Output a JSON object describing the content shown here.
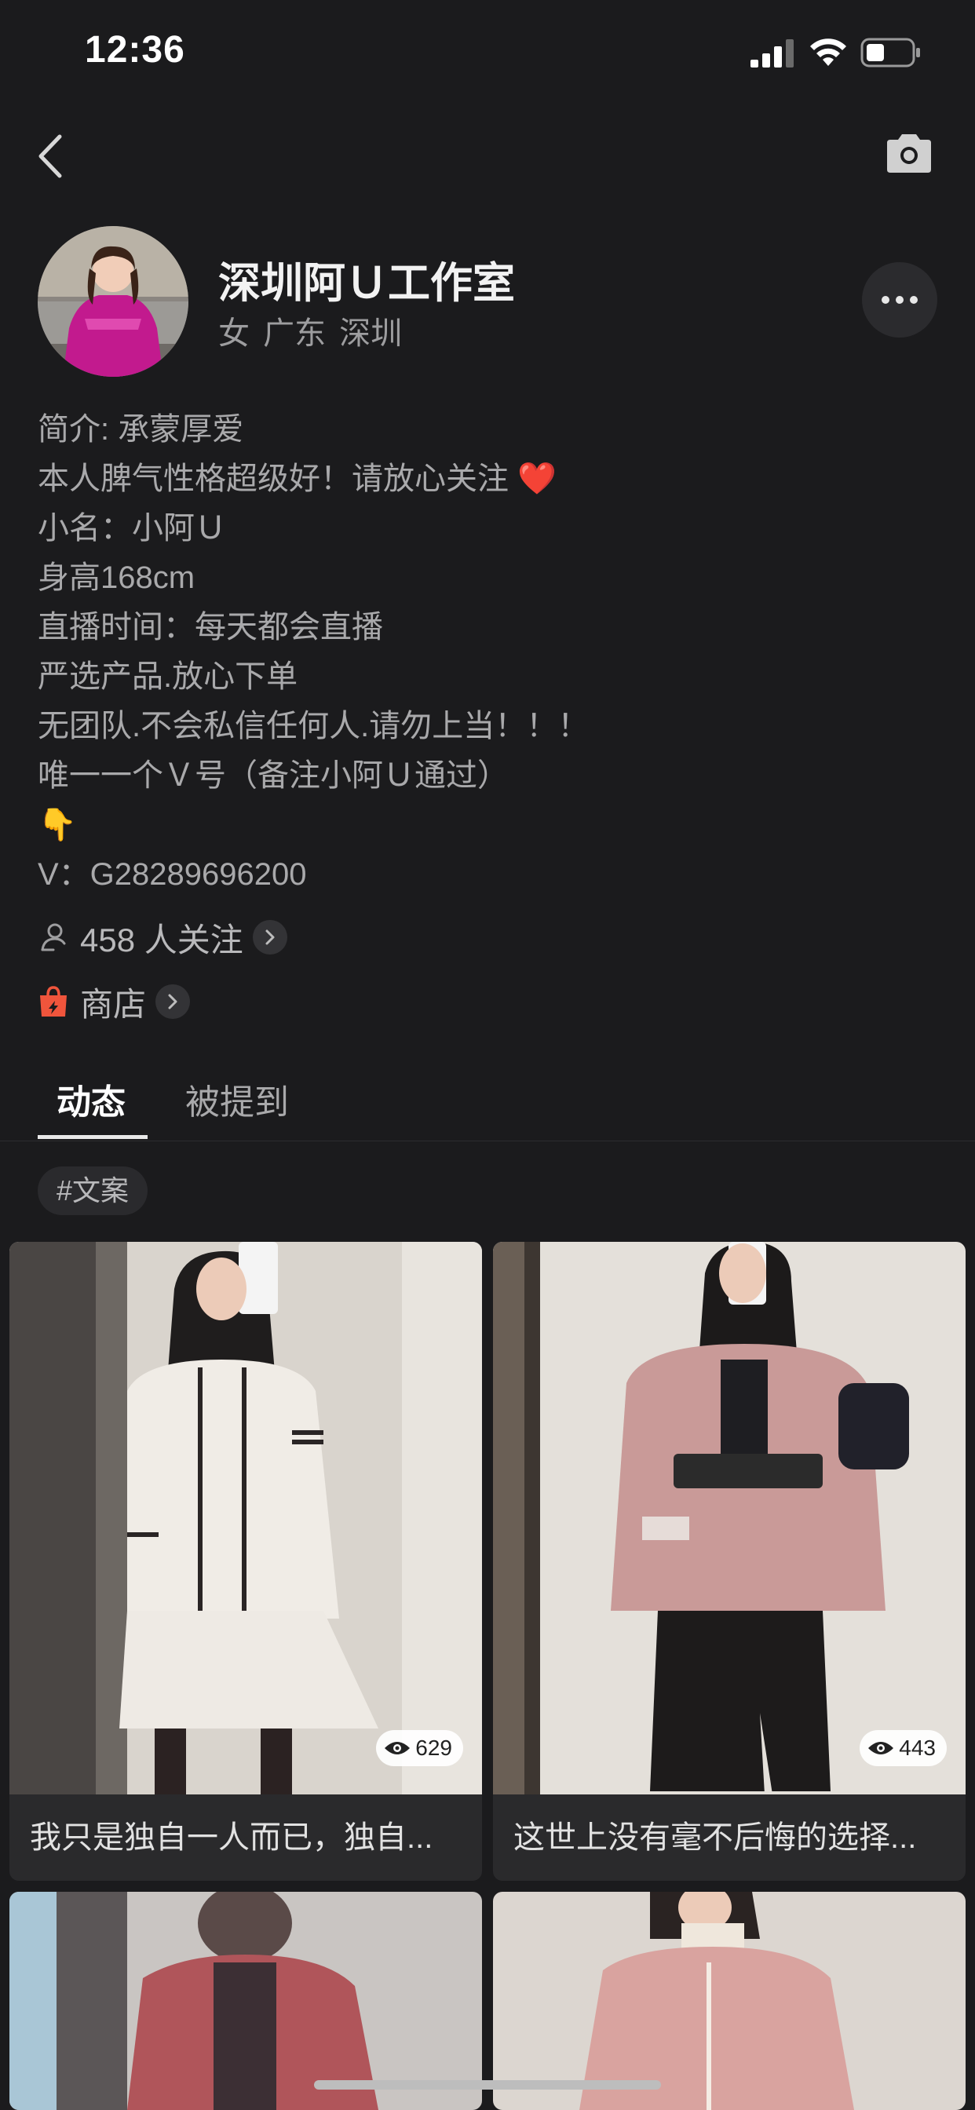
{
  "status_bar": {
    "time": "12:36"
  },
  "profile": {
    "name": "深圳阿Ｕ工作室",
    "meta": "女  广东 深圳",
    "bio_lines": [
      "简介: 承蒙厚爱",
      "本人脾气性格超级好！请放心关注",
      "小名：小阿Ｕ",
      "身高168cm",
      "直播时间：每天都会直播",
      "严选产品.放心下单",
      "无团队.不会私信任何人.请勿上当！！！",
      "唯一一个Ｖ号（备注小阿Ｕ通过）",
      "👇",
      "V：G28289696200"
    ],
    "bio_heart": "❤️",
    "followers": "458 人关注",
    "shop": "商店"
  },
  "tabs": [
    {
      "label": "动态"
    },
    {
      "label": "被提到"
    }
  ],
  "hashtag": "#文案",
  "posts": [
    {
      "views": "629",
      "caption": "我只是独自一人而已，独自..."
    },
    {
      "views": "443",
      "caption": "这世上没有毫不后悔的选择..."
    },
    {
      "views": "",
      "caption": ""
    },
    {
      "views": "",
      "caption": ""
    }
  ],
  "icons": {
    "back": "chevron-left-icon",
    "camera": "camera-icon",
    "more": "more-dots-icon",
    "followers": "user-icon",
    "shop": "shopping-bag-icon",
    "views": "eye-icon"
  },
  "colors": {
    "background": "#1b1b1d",
    "accent_shop": "#f0553c",
    "heart": "#e8242b"
  }
}
